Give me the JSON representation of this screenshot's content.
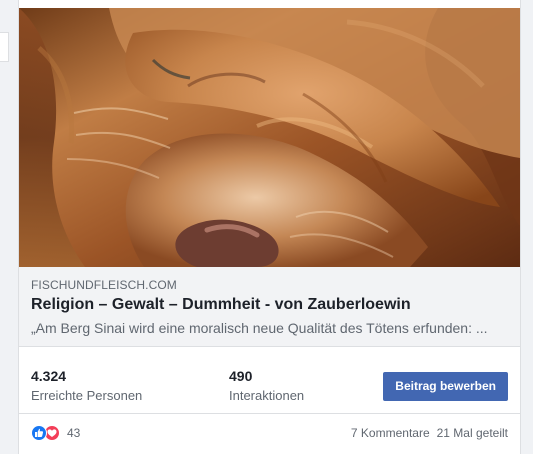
{
  "post": {
    "image": {
      "subject": "Löwe mit Pfote vor dem Gesicht"
    },
    "link_preview": {
      "domain": "FISCHUNDFLEISCH.COM",
      "title": "Religion – Gewalt – Dummheit - von Zauberloewin",
      "description": "„Am Berg Sinai wird eine moralisch neue Qualität des Tötens erfunden: ..."
    },
    "stats": {
      "reach_value": "4.324",
      "reach_label": "Erreichte Personen",
      "interactions_value": "490",
      "interactions_label": "Interaktionen",
      "promote_button": "Beitrag bewerben"
    },
    "engagement": {
      "reactions_count": "43",
      "comments": "7 Kommentare",
      "shares": "21 Mal geteilt"
    },
    "icons": {
      "like": "thumbs-up-icon",
      "love": "heart-icon"
    },
    "colors": {
      "brand_blue": "#4267b2",
      "like_blue": "#1877f2",
      "love_red": "#f33e58",
      "link_background": "#f2f3f5"
    }
  }
}
